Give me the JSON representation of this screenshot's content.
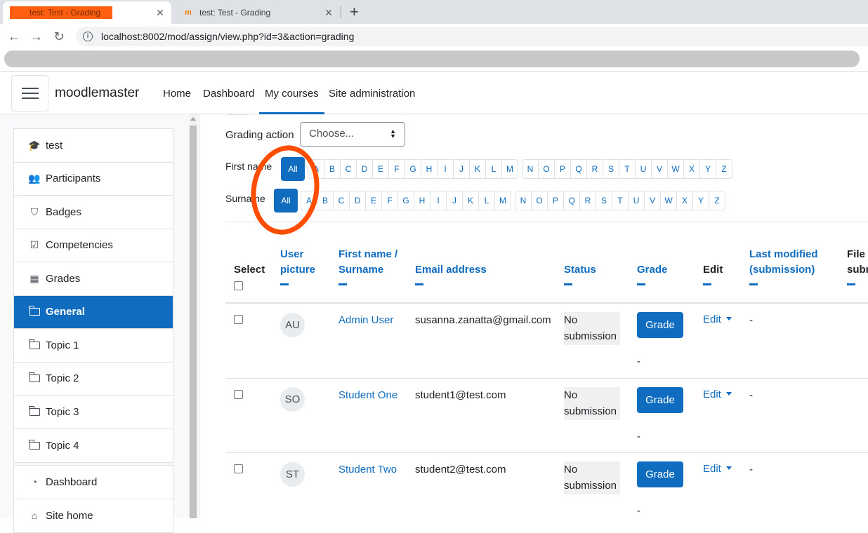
{
  "browser": {
    "tabs": [
      {
        "title": "test: Test - Grading",
        "active": true
      },
      {
        "title": "test: Test - Grading",
        "active": false
      }
    ],
    "new_tab": "+",
    "close": "✕",
    "url": "localhost:8002/mod/assign/view.php?id=3&action=grading"
  },
  "navbar": {
    "brand": "moodlemaster",
    "links": [
      "Home",
      "Dashboard",
      "My courses",
      "Site administration"
    ],
    "active_link": "My courses"
  },
  "sidebar": {
    "course_items": [
      {
        "label": "test",
        "icon": "graduation-cap-icon"
      },
      {
        "label": "Participants",
        "icon": "users-icon"
      },
      {
        "label": "Badges",
        "icon": "shield-icon"
      },
      {
        "label": "Competencies",
        "icon": "check-square-icon"
      },
      {
        "label": "Grades",
        "icon": "table-icon"
      },
      {
        "label": "General",
        "icon": "folder-icon",
        "active": true
      },
      {
        "label": "Topic 1",
        "icon": "folder-icon"
      },
      {
        "label": "Topic 2",
        "icon": "folder-icon"
      },
      {
        "label": "Topic 3",
        "icon": "folder-icon"
      },
      {
        "label": "Topic 4",
        "icon": "folder-icon"
      }
    ],
    "site_items": [
      {
        "label": "Dashboard",
        "icon": "dashboard-icon"
      },
      {
        "label": "Site home",
        "icon": "home-icon"
      }
    ]
  },
  "grading": {
    "action_label": "Grading action",
    "action_select": "Choose...",
    "first_name_label": "First name",
    "surname_label": "Surname",
    "all_label": "All",
    "letters_1": [
      "A",
      "B",
      "C",
      "D",
      "E",
      "F",
      "G",
      "H",
      "I",
      "J",
      "K",
      "L",
      "M"
    ],
    "letters_2": [
      "N",
      "O",
      "P",
      "Q",
      "R",
      "S",
      "T",
      "U",
      "V",
      "W",
      "X",
      "Y",
      "Z"
    ]
  },
  "table": {
    "headers": {
      "select": "Select",
      "user_picture": "User picture",
      "name": "First name / Surname",
      "email": "Email address",
      "status": "Status",
      "grade": "Grade",
      "edit": "Edit",
      "last_modified": "Last modified (submission)",
      "file": "File subm"
    },
    "rows": [
      {
        "initials": "AU",
        "name": "Admin User",
        "email": "susanna.zanatta@gmail.com",
        "status": "No submission",
        "grade_button": "Grade",
        "grade_value": "-",
        "edit": "Edit",
        "last_modified": "-"
      },
      {
        "initials": "SO",
        "name": "Student One",
        "email": "student1@test.com",
        "status": "No submission",
        "grade_button": "Grade",
        "grade_value": "-",
        "edit": "Edit",
        "last_modified": "-"
      },
      {
        "initials": "ST",
        "name": "Student Two",
        "email": "student2@test.com",
        "status": "No submission",
        "grade_button": "Grade",
        "grade_value": "-",
        "edit": "Edit",
        "last_modified": "-"
      }
    ]
  },
  "colors": {
    "accent": "#0f6cbf",
    "annotation": "#ff4d00"
  }
}
